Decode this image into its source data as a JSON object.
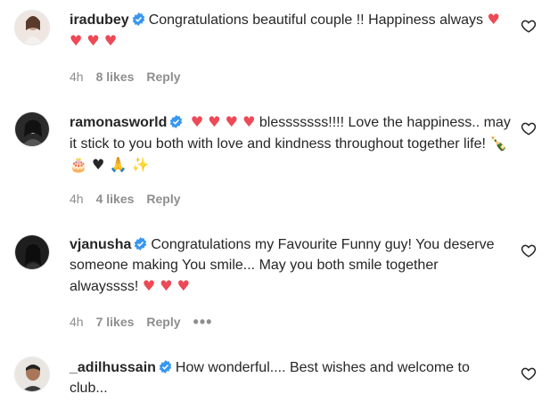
{
  "comments": [
    {
      "username": "iradubey",
      "text": "Congratulations beautiful couple !! Happiness always",
      "emojis": "♥ ♥ ♥ ♥",
      "time": "4h",
      "likes": "8 likes",
      "reply": "Reply"
    },
    {
      "username": "ramonasworld",
      "emojis_pre": "♥ ♥ ♥ ♥",
      "text": "blesssssss!!!! Love the happiness.. may it stick to you both with love and kindness throughout together life!",
      "emojis_post": "🍾 🎂 ♥ 🙏 ✨",
      "time": "4h",
      "likes": "4 likes",
      "reply": "Reply"
    },
    {
      "username": "vjanusha",
      "text": "Congratulations my Favourite Funny guy! You deserve someone making You smile... May you both smile together alwayssss!",
      "emojis": "♥ ♥ ♥",
      "time": "4h",
      "likes": "7 likes",
      "reply": "Reply",
      "more": "•••"
    },
    {
      "username": "_adilhussain",
      "text": "How wonderful.... Best wishes and welcome to club..."
    }
  ],
  "colors": {
    "verified": "#3897f0",
    "heart": "#ed4956",
    "meta": "#8e8e8e"
  },
  "icons": {
    "like": "heart-outline-icon",
    "verified": "verified-badge-icon"
  }
}
